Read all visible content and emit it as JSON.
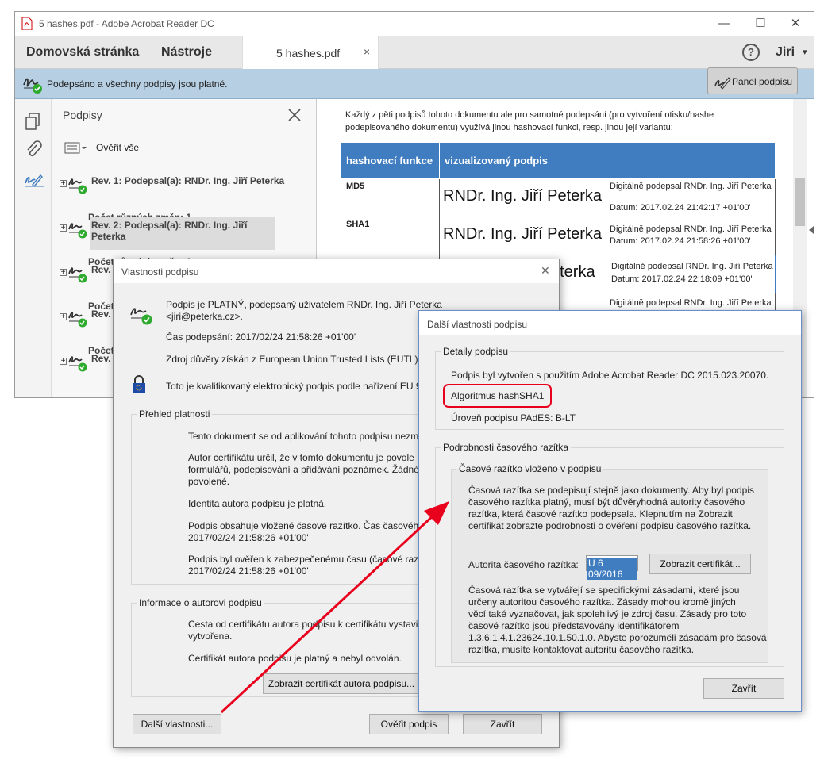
{
  "window": {
    "title": "5 hashes.pdf - Adobe Acrobat Reader DC",
    "min": "—",
    "max": "☐",
    "close": "✕"
  },
  "menu": {
    "home": "Domovská stránka",
    "tools": "Nástroje",
    "tab": "5 hashes.pdf",
    "tab_close": "×",
    "help": "?",
    "user": "Jiri",
    "user_caret": "▾"
  },
  "sigbar": {
    "status": "Podepsáno a všechny podpisy jsou platné.",
    "panel_button": "Panel podpisu"
  },
  "signatures_panel": {
    "title": "Podpisy",
    "verify_all": "Ověřit vše",
    "revs": [
      {
        "label": "Rev. 1: Podepsal(a): RNDr. Ing. Jiří Peterka",
        "changes": "Počet různých změn: 1"
      },
      {
        "label": "Rev. 2: Podepsal(a): RNDr. Ing. Jiří Peterka",
        "changes": "Počet různých změn: 1"
      },
      {
        "label": "Rev.",
        "changes": "Počet"
      },
      {
        "label": "Rev.",
        "changes": "Počet"
      },
      {
        "label": "Rev."
      }
    ]
  },
  "doc": {
    "intro": "Každý z pěti podpisů tohoto dokumentu ale pro samotné podepsání (pro vytvoření otisku/hashe podepisovaného dokumentu) využívá jinou hashovací funkci, resp. jinou její variantu:",
    "col1": "hashovací funkce",
    "col2": "vizualizovaný podpis",
    "rows": [
      {
        "hash": "MD5",
        "name": "RNDr. Ing. Jiří Peterka",
        "info1": "Digitálně podepsal RNDr. Ing. Jiří Peterka",
        "info2": "Datum: 2017.02.24 21:42:17 +01'00'"
      },
      {
        "hash": "SHA1",
        "name": "RNDr. Ing. Jiří Peterka",
        "info1": "Digitálně podepsal RNDr. Ing. Jiří Peterka",
        "info2": "Datum: 2017.02.24 21:58:26 +01'00'"
      },
      {
        "hash": "",
        "name": "eterka",
        "info1": "Digitálně podepsal RNDr. Ing. Jiří Peterka",
        "info2": "Datum: 2017.02.24 22:18:09 +01'00'"
      },
      {
        "hash": "",
        "name": "",
        "info1": "Digitálně podepsal RNDr. Ing. Jiří Peterka",
        "info2": ""
      }
    ]
  },
  "props_dialog": {
    "title": "Vlastnosti podpisu",
    "close": "✕",
    "valid": "Podpis je PLATNÝ, podepsaný uživatelem RNDr. Ing. Jiří Peterka",
    "email": "<jiri@peterka.cz>.",
    "time": "Čas podepsání:  2017/02/24 21:58:26 +01'00'",
    "trust": "Zdroj důvěry získán z European Union Trusted Lists (EUTL).",
    "qualified": "Toto je kvalifikovaný elektronický podpis podle nařízení EU 9",
    "overview_legend": "Přehled platnosti",
    "overview": [
      "Tento dokument se od aplikování tohoto podpisu nezm",
      "Autor certifikátu určil, že v tomto dokumentu je povole",
      "formulářů, podepisování a přidávání poznámek. Žádné",
      "povolené.",
      "Identita autora podpisu je platná.",
      "Podpis obsahuje vložené časové razítko. Čas časového",
      "2017/02/24 21:58:26 +01'00'",
      "Podpis byl ověřen k zabezpečenému času (časové razítk",
      "2017/02/24 21:58:26 +01'00'"
    ],
    "author_legend": "Informace o autorovi podpisu",
    "author": [
      "Cesta od certifikátu autora podpisu k certifikátu vystavi",
      "vytvořena.",
      "Certifikát autora podpisu je platný a nebyl odvolán."
    ],
    "show_cert": "Zobrazit certifikát autora podpisu...",
    "more": "Další vlastnosti...",
    "verify": "Ověřit podpis",
    "close_btn": "Zavřít"
  },
  "more_dialog": {
    "title": "Další vlastnosti podpisu",
    "details_legend": "Detaily podpisu",
    "created": "Podpis byl vytvořen s použitím Adobe Acrobat Reader DC 2015.023.20070.",
    "algorithm": "Algoritmus hashSHA1",
    "level": "Úroveň podpisu PAdES: B-LT",
    "ts_legend": "Podrobnosti časového razítka",
    "ts_inner_legend": "Časové razítko vloženo v podpisu",
    "ts_text": [
      "Časová razítka se podepisují stejně jako dokumenty. Aby byl podpis",
      "časového razítka platný, musí být důvěryhodná autority časového",
      "razítka, která časové razítko podepsala. Klepnutím na Zobrazit",
      "certifikát zobrazte podrobnosti o ověření podpisu časového razítka."
    ],
    "authority_label": "Autorita časového razítka:",
    "authority_value": "U 6 09/2016",
    "show_cert": "Zobrazit certifikát...",
    "policy": [
      "Časová razítka se vytvářejí se specifickými zásadami, které jsou",
      "určeny autoritou časového razítka. Zásady mohou kromě jiných",
      "věcí také vyznačovat, jak spolehlivý je zdroj času. Zásady pro toto",
      "časové razítko jsou představovány identifikátorem",
      "1.3.6.1.4.1.23624.10.1.50.1.0. Abyste porozuměli zásadám pro časová",
      "razítka, musíte kontaktovat autoritu časového razítka."
    ],
    "close_btn": "Zavřít"
  },
  "colors": {
    "accent": "#3f7cc0",
    "highlight": "#e8001c",
    "valid": "#2eaa2e",
    "arrow": "#e8001c"
  }
}
